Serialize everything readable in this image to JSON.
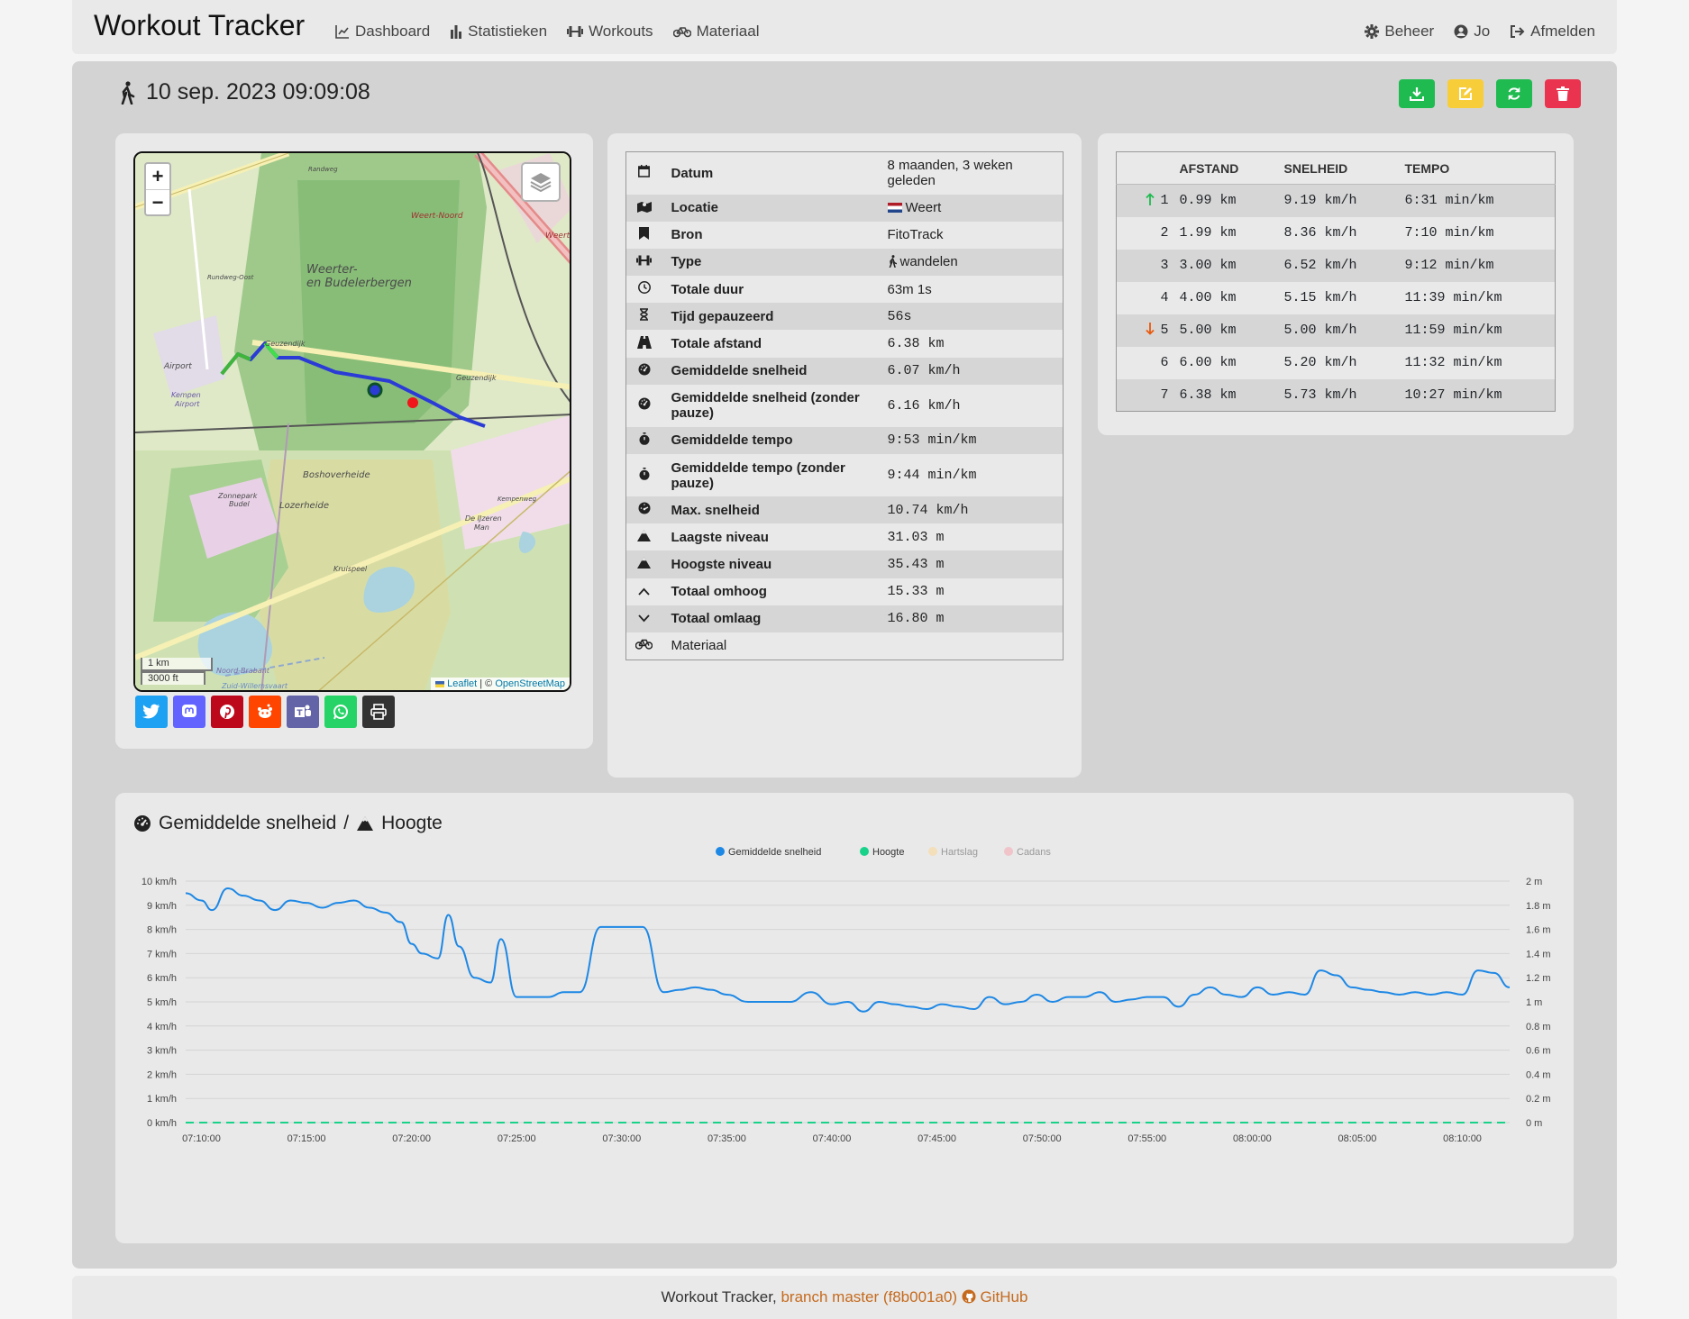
{
  "nav": {
    "brand": "Workout Tracker",
    "left": [
      {
        "label": "Dashboard",
        "icon": "chart-line-icon"
      },
      {
        "label": "Statistieken",
        "icon": "bar-chart-icon"
      },
      {
        "label": "Workouts",
        "icon": "dumbbell-icon"
      },
      {
        "label": "Materiaal",
        "icon": "bicycle-icon"
      }
    ],
    "right": [
      {
        "label": "Beheer",
        "icon": "gear-icon"
      },
      {
        "label": "Jo",
        "icon": "user-circle-icon"
      },
      {
        "label": "Afmelden",
        "icon": "sign-out-icon"
      }
    ]
  },
  "workout": {
    "title": "10 sep. 2023 09:09:08",
    "icon": "walking-icon",
    "actions": [
      {
        "name": "download",
        "color": "#1fbb50"
      },
      {
        "name": "edit",
        "color": "#f8cd3a"
      },
      {
        "name": "refresh",
        "color": "#1fbb50"
      },
      {
        "name": "delete",
        "color": "#e9334f"
      }
    ]
  },
  "map": {
    "zoom_in": "+",
    "zoom_out": "−",
    "scale_km": "1 km",
    "scale_ft": "3000 ft",
    "attrib_leaflet": "Leaflet",
    "attrib_sep": " | © ",
    "attrib_osm": "OpenStreetMap",
    "labels": [
      "Weerter-",
      "en Budelerbergen",
      "Weert-Noord",
      "Weert",
      "Airport",
      "Kempen",
      "Airport",
      "Geuzendijk",
      "Geuzendijk",
      "Boshoverheide",
      "Lozerheide",
      "Zonnepark",
      "Budel",
      "De IJzeren",
      "Man",
      "Kruispeel",
      "Kempenweg",
      "Randweg",
      "Rundweg-Oost",
      "Noord-Brabant",
      "Zuid-Willemsvaart"
    ]
  },
  "share": [
    {
      "name": "twitter",
      "color": "#1da1f2"
    },
    {
      "name": "mastodon",
      "color": "#6364ff"
    },
    {
      "name": "pinterest",
      "color": "#bd081c"
    },
    {
      "name": "reddit",
      "color": "#ff4500"
    },
    {
      "name": "teams",
      "color": "#6264a7"
    },
    {
      "name": "whatsapp",
      "color": "#25d366"
    },
    {
      "name": "print",
      "color": "#333333"
    }
  ],
  "details": [
    {
      "icon": "calendar-icon",
      "label": "Datum",
      "value": "8 maanden, 3 weken geleden",
      "mono": false
    },
    {
      "icon": "map-location-icon",
      "label": "Locatie",
      "value": "Weert",
      "flag": true,
      "mono": false
    },
    {
      "icon": "bookmark-icon",
      "label": "Bron",
      "value": "FitoTrack",
      "mono": false
    },
    {
      "icon": "dumbbell-icon",
      "label": "Type",
      "value": "wandelen",
      "walker": true,
      "mono": false
    },
    {
      "icon": "clock-icon",
      "label": "Totale duur",
      "value": "63m 1s",
      "mono": false
    },
    {
      "icon": "hourglass-icon",
      "label": "Tijd gepauzeerd",
      "value": "56s",
      "mono": true
    },
    {
      "icon": "road-icon",
      "label": "Totale afstand",
      "value": "6.38 km",
      "mono": true
    },
    {
      "icon": "gauge-icon",
      "label": "Gemiddelde snelheid",
      "value": "6.07 km/h",
      "mono": true
    },
    {
      "icon": "gauge-icon",
      "label": "Gemiddelde snelheid (zonder pauze)",
      "value": "6.16 km/h",
      "mono": true
    },
    {
      "icon": "stopwatch-icon",
      "label": "Gemiddelde tempo",
      "value": "9:53 min/km",
      "mono": true
    },
    {
      "icon": "stopwatch-icon",
      "label": "Gemiddelde tempo (zonder pauze)",
      "value": "9:44 min/km",
      "mono": true
    },
    {
      "icon": "gauge-high-icon",
      "label": "Max. snelheid",
      "value": "10.74 km/h",
      "mono": true
    },
    {
      "icon": "mountain-icon",
      "label": "Laagste niveau",
      "value": "31.03 m",
      "mono": true
    },
    {
      "icon": "mountain-icon",
      "label": "Hoogste niveau",
      "value": "35.43 m",
      "mono": true
    },
    {
      "icon": "chevron-up-icon",
      "label": "Totaal omhoog",
      "value": "15.33 m",
      "mono": true
    },
    {
      "icon": "chevron-down-icon",
      "label": "Totaal omlaag",
      "value": "16.80 m",
      "mono": true
    },
    {
      "icon": "bicycle-icon",
      "label": "Materiaal",
      "value": "",
      "mono": false,
      "plain": true
    }
  ],
  "laps": {
    "headers": [
      "AFSTAND",
      "SNELHEID",
      "TEMPO"
    ],
    "rows": [
      {
        "marker": "up",
        "n": "1",
        "dist": "0.99 km",
        "speed": "9.19 km/h",
        "tempo": "6:31 min/km"
      },
      {
        "marker": "",
        "n": "2",
        "dist": "1.99 km",
        "speed": "8.36 km/h",
        "tempo": "7:10 min/km"
      },
      {
        "marker": "",
        "n": "3",
        "dist": "3.00 km",
        "speed": "6.52 km/h",
        "tempo": "9:12 min/km"
      },
      {
        "marker": "",
        "n": "4",
        "dist": "4.00 km",
        "speed": "5.15 km/h",
        "tempo": "11:39 min/km"
      },
      {
        "marker": "down",
        "n": "5",
        "dist": "5.00 km",
        "speed": "5.00 km/h",
        "tempo": "11:59 min/km"
      },
      {
        "marker": "",
        "n": "6",
        "dist": "6.00 km",
        "speed": "5.20 km/h",
        "tempo": "11:32 min/km"
      },
      {
        "marker": "",
        "n": "7",
        "dist": "6.38 km",
        "speed": "5.73 km/h",
        "tempo": "10:27 min/km"
      }
    ],
    "up_color": "#1fbb50",
    "down_color": "#e8590c"
  },
  "chart_title": {
    "speed": "Gemiddelde snelheid",
    "sep": "/",
    "height": "Hoogte"
  },
  "chart_data": {
    "type": "line",
    "legend": [
      {
        "name": "Gemiddelde snelheid",
        "color": "#1e88e5",
        "active": true
      },
      {
        "name": "Hoogte",
        "color": "#19d28a",
        "active": true
      },
      {
        "name": "Hartslag",
        "color": "#f3dfb9",
        "active": false
      },
      {
        "name": "Cadans",
        "color": "#f0c4c8",
        "active": false
      }
    ],
    "legend_position": "top-center",
    "y_left": {
      "ticks": [
        "0 km/h",
        "1 km/h",
        "2 km/h",
        "3 km/h",
        "4 km/h",
        "5 km/h",
        "6 km/h",
        "7 km/h",
        "8 km/h",
        "9 km/h",
        "10 km/h"
      ],
      "range": [
        0,
        10
      ]
    },
    "y_right": {
      "ticks": [
        "0 m",
        "0.2 m",
        "0.4 m",
        "0.6 m",
        "0.8 m",
        "1 m",
        "1.2 m",
        "1.4 m",
        "1.6 m",
        "1.8 m",
        "2 m"
      ],
      "range": [
        0,
        2
      ]
    },
    "x_ticks": [
      "07:10:00",
      "07:15:00",
      "07:20:00",
      "07:25:00",
      "07:30:00",
      "07:35:00",
      "07:40:00",
      "07:45:00",
      "07:50:00",
      "07:55:00",
      "08:00:00",
      "08:05:00",
      "08:10:00"
    ],
    "x_range": [
      "07:09:15",
      "08:12:15"
    ],
    "series": [
      {
        "name": "Gemiddelde snelheid",
        "x": [
          "07:09:15",
          "07:10:00",
          "07:10:30",
          "07:11:15",
          "07:12:00",
          "07:12:45",
          "07:13:30",
          "07:14:15",
          "07:15:00",
          "07:15:45",
          "07:16:30",
          "07:17:15",
          "07:18:00",
          "07:18:45",
          "07:19:30",
          "07:20:00",
          "07:20:30",
          "07:21:15",
          "07:21:45",
          "07:22:15",
          "07:23:00",
          "07:23:45",
          "07:24:15",
          "07:25:00",
          "07:25:45",
          "07:26:30",
          "07:27:15",
          "07:28:00",
          "07:29:00",
          "07:30:00",
          "07:31:00",
          "07:32:00",
          "07:32:45",
          "07:33:30",
          "07:34:15",
          "07:35:00",
          "07:36:00",
          "07:37:00",
          "07:38:00",
          "07:39:00",
          "07:40:00",
          "07:40:45",
          "07:41:30",
          "07:42:15",
          "07:43:00",
          "07:43:45",
          "07:44:30",
          "07:45:15",
          "07:46:00",
          "07:46:45",
          "07:47:30",
          "07:48:15",
          "07:49:00",
          "07:49:45",
          "07:50:30",
          "07:51:15",
          "07:52:00",
          "07:52:45",
          "07:53:30",
          "07:54:15",
          "07:55:00",
          "07:55:45",
          "07:56:30",
          "07:57:15",
          "07:58:00",
          "07:58:45",
          "07:59:30",
          "08:00:15",
          "08:01:00",
          "08:01:45",
          "08:02:30",
          "08:03:15",
          "08:04:00",
          "08:04:45",
          "08:05:30",
          "08:06:15",
          "08:07:00",
          "08:07:45",
          "08:08:30",
          "08:09:15",
          "08:10:00",
          "08:10:45",
          "08:11:30",
          "08:12:15"
        ],
        "values": [
          9.5,
          9.2,
          8.8,
          9.7,
          9.4,
          9.2,
          8.8,
          9.2,
          9.1,
          8.9,
          9.1,
          9.2,
          8.9,
          8.7,
          8.3,
          7.4,
          7.0,
          6.8,
          8.6,
          7.3,
          6.0,
          5.8,
          7.6,
          5.2,
          5.2,
          5.2,
          5.4,
          5.4,
          8.1,
          8.1,
          8.1,
          5.4,
          5.5,
          5.6,
          5.5,
          5.3,
          5.0,
          5.0,
          5.0,
          5.4,
          4.9,
          5.0,
          4.6,
          5.0,
          4.9,
          4.8,
          4.7,
          4.9,
          4.8,
          4.7,
          5.2,
          4.9,
          5.0,
          5.3,
          5.0,
          5.2,
          5.2,
          5.4,
          5.0,
          5.1,
          5.2,
          5.2,
          4.8,
          5.3,
          5.6,
          5.3,
          5.2,
          5.6,
          5.3,
          5.4,
          5.3,
          6.3,
          6.1,
          5.6,
          5.5,
          5.4,
          5.3,
          5.4,
          5.3,
          5.4,
          5.3,
          6.3,
          6.2,
          5.6
        ]
      },
      {
        "name": "Hoogte",
        "x": [
          "07:09:15",
          "08:12:15"
        ],
        "values": [
          0,
          0
        ],
        "dashed": true
      }
    ]
  },
  "footer": {
    "prefix": "Workout Tracker,",
    "branch": "branch master (f8b001a0)",
    "github": "GitHub"
  }
}
